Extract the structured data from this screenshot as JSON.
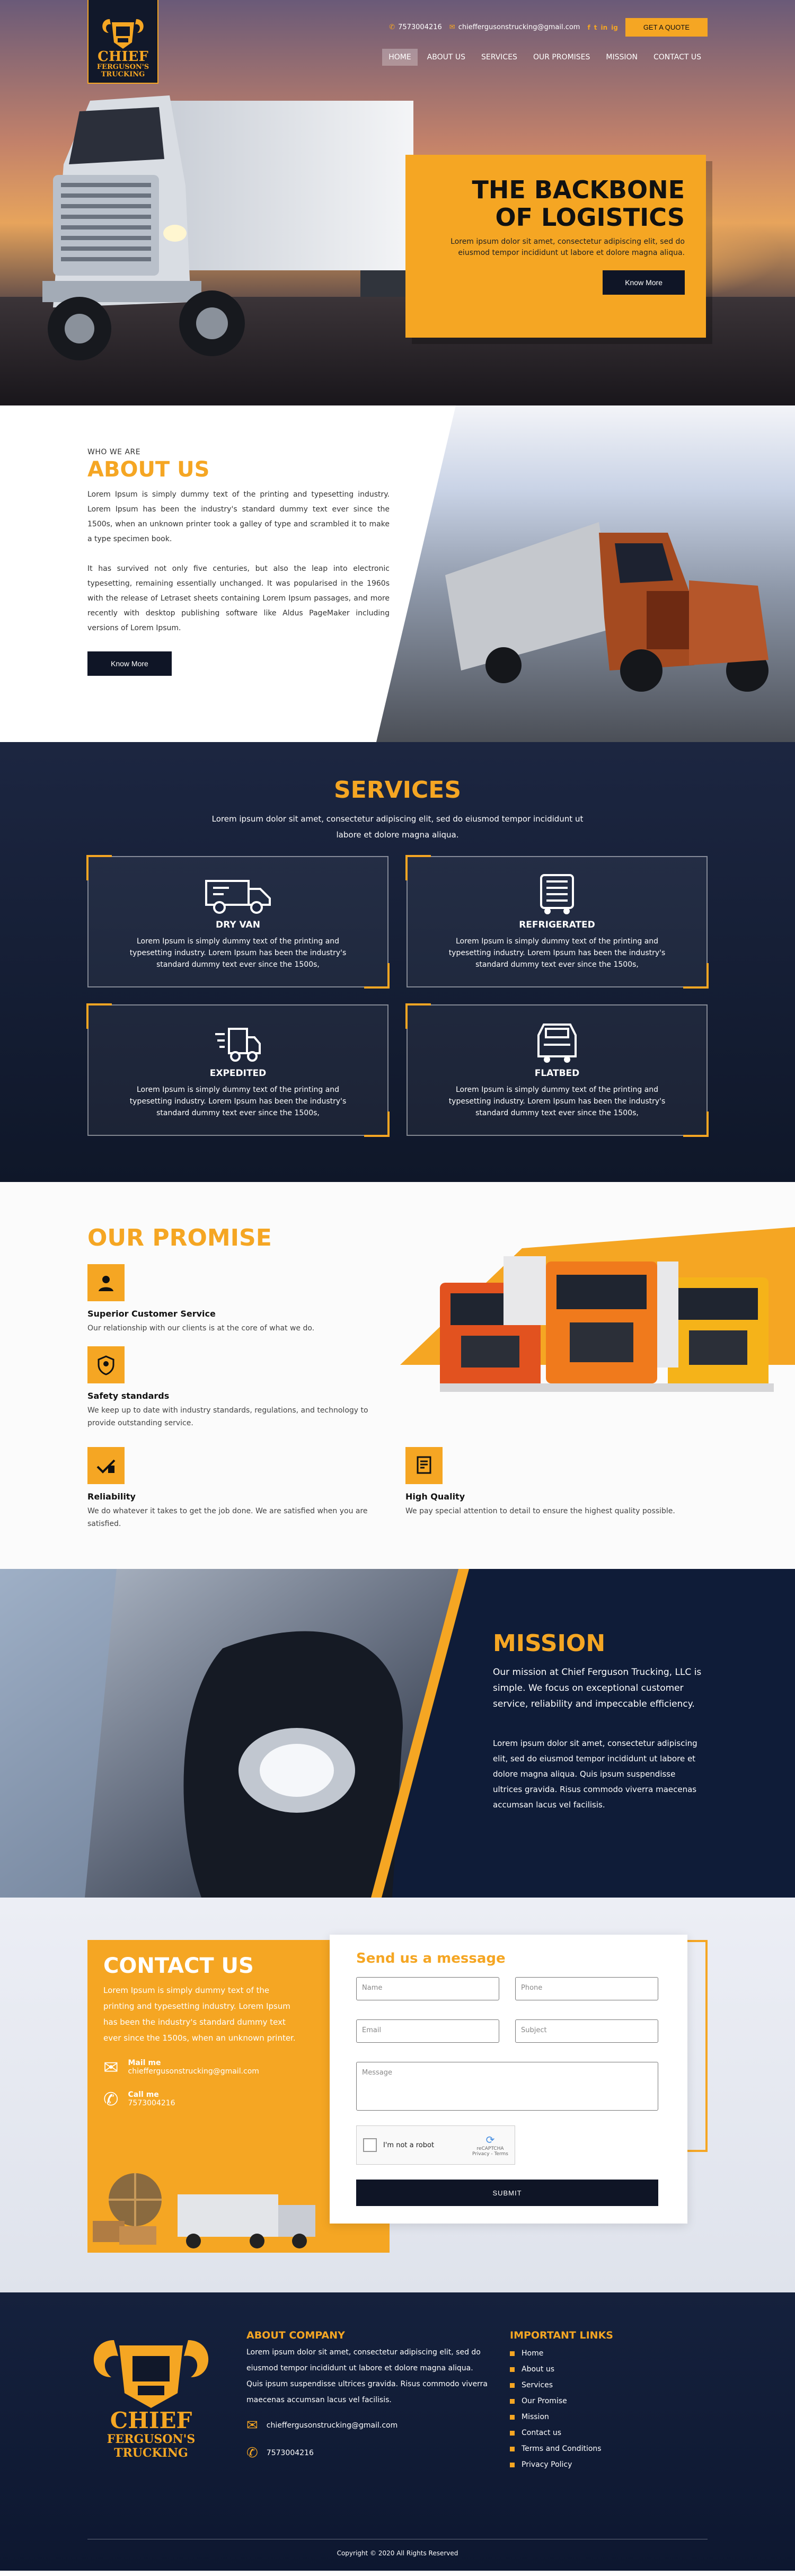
{
  "brand": {
    "line1": "CHIEF",
    "line2": "FERGUSON'S",
    "line3": "TRUCKING"
  },
  "header": {
    "phone": "7573004216",
    "email": "chieffergusonstrucking@gmail.com",
    "social": [
      "f",
      "t",
      "in",
      "ig"
    ],
    "quote_button": "GET A QUOTE"
  },
  "nav": [
    {
      "label": "HOME",
      "active": true
    },
    {
      "label": "ABOUT US"
    },
    {
      "label": "SERVICES"
    },
    {
      "label": "OUR PROMISES"
    },
    {
      "label": "MISSION"
    },
    {
      "label": "CONTACT US"
    }
  ],
  "hero": {
    "title": "THE BACKBONE OF LOGISTICS",
    "text": "Lorem ipsum dolor sit amet, consectetur adipiscing elit, sed do eiusmod tempor incididunt ut labore et dolore magna aliqua.",
    "button": "Know More"
  },
  "about": {
    "label": "WHO WE ARE",
    "title": "ABOUT US",
    "p1": "Lorem Ipsum is simply dummy text of the printing and typesetting industry. Lorem Ipsum has been the industry's standard dummy text ever since the 1500s, when an unknown printer took a galley of type and scrambled it to make a type specimen book.",
    "p2": "It has survived not only five centuries, but also the leap into electronic typesetting, remaining essentially unchanged. It was popularised in the 1960s with the release of Letraset sheets containing Lorem Ipsum passages, and more recently with desktop publishing software like Aldus PageMaker including versions of Lorem Ipsum.",
    "button": "Know More"
  },
  "services": {
    "title": "SERVICES",
    "intro": "Lorem ipsum dolor sit amet, consectetur adipiscing elit, sed do eiusmod tempor incididunt ut labore et dolore magna aliqua.",
    "items": [
      {
        "title": "DRY VAN",
        "icon": "van-icon",
        "text": "Lorem Ipsum is simply dummy text of the printing and typesetting industry. Lorem Ipsum has been the industry's standard dummy text ever since the 1500s,"
      },
      {
        "title": "REFRIGERATED",
        "icon": "refrigerated-truck-icon",
        "text": "Lorem Ipsum is simply dummy text of the printing and typesetting industry. Lorem Ipsum has been the industry's standard dummy text ever since the 1500s,"
      },
      {
        "title": "EXPEDITED",
        "icon": "fast-delivery-icon",
        "text": "Lorem Ipsum is simply dummy text of the printing and typesetting industry. Lorem Ipsum has been the industry's standard dummy text ever since the 1500s,"
      },
      {
        "title": "FLATBED",
        "icon": "flatbed-truck-icon",
        "text": "Lorem Ipsum is simply dummy text of the printing and typesetting industry. Lorem Ipsum has been the industry's standard dummy text ever since the 1500s,"
      }
    ]
  },
  "promise": {
    "title": "OUR PROMISE",
    "items": [
      {
        "title": "Superior Customer Service",
        "text": "Our relationship with our clients is at the core of what we do."
      },
      {
        "title": "Safety standards",
        "text": "We keep up to date with industry standards, regulations, and technology to provide outstanding service."
      },
      {
        "title": "Reliability",
        "text": "We do whatever it takes to get the job done. We are satisfied when you are satisfied."
      },
      {
        "title": "High Quality",
        "text": "We pay special attention to detail to ensure the highest quality possible."
      }
    ]
  },
  "mission": {
    "title": "MISSION",
    "p1": "Our mission at Chief Ferguson Trucking, LLC is simple. We focus on exceptional customer service, reliability and impeccable efficiency.",
    "p2": "Lorem ipsum dolor sit amet, consectetur adipiscing elit, sed do eiusmod tempor incididunt ut labore et dolore magna aliqua. Quis ipsum suspendisse ultrices gravida. Risus commodo viverra maecenas accumsan lacus vel facilisis."
  },
  "contact": {
    "title": "CONTACT US",
    "text": "Lorem Ipsum is simply dummy text of the printing and typesetting industry. Lorem Ipsum has been the industry's standard dummy text ever since the 1500s, when an unknown printer.",
    "mail_label": "Mail me",
    "mail": "chieffergusonstrucking@gmail.com",
    "call_label": "Call me",
    "phone": "7573004216",
    "form": {
      "title": "Send us a message",
      "name": "Name",
      "phone": "Phone",
      "email": "Email",
      "subject": "Subject",
      "message": "Message",
      "captcha": "I'm not a robot",
      "captcha_brand": "reCAPTCHA",
      "captcha_terms": "Privacy - Terms",
      "submit": "SUBMIT"
    }
  },
  "footer": {
    "about_title": "ABOUT COMPANY",
    "about_text": "Lorem ipsum dolor sit amet, consectetur adipiscing elit, sed do eiusmod tempor incididunt ut labore et dolore magna aliqua. Quis ipsum suspendisse ultrices gravida. Risus commodo viverra maecenas accumsan lacus vel facilisis.",
    "email": "chieffergusonstrucking@gmail.com",
    "phone": "7573004216",
    "links_title": "IMPORTANT LINKS",
    "links": [
      "Home",
      "About us",
      "Services",
      "Our Promise",
      "Mission",
      "Contact us",
      "Terms and Conditions",
      "Privacy Policy"
    ],
    "copyright": "Copyright © 2020 All Rights Reserved"
  },
  "colors": {
    "accent": "#f5a623",
    "navy": "#0f1526"
  }
}
